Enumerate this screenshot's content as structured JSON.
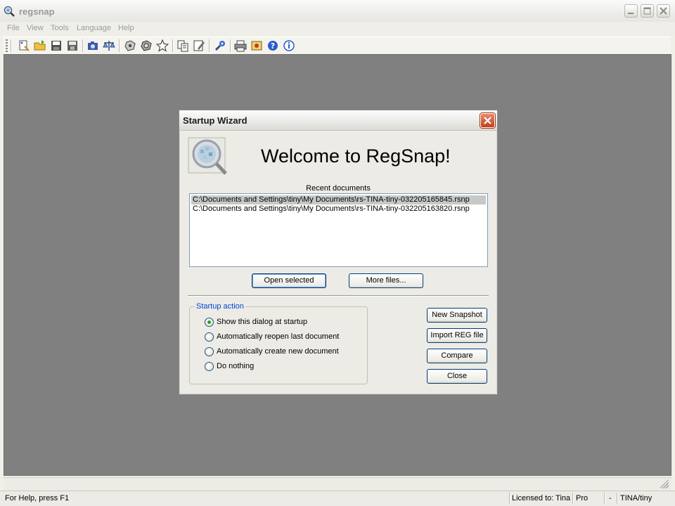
{
  "window": {
    "title": "regsnap",
    "icon": "magnifier-icon"
  },
  "menu": [
    "File",
    "View",
    "Tools",
    "Language",
    "Help"
  ],
  "toolbar": {
    "icons": [
      "new-wizard-icon",
      "open-folder-icon",
      "save-icon",
      "save-as-icon",
      "snapshot-icon",
      "compare-scales-icon",
      "registry-icon",
      "registry-alt-icon",
      "favorites-star-icon",
      "copy-icon",
      "edit-icon",
      "tools-icon",
      "print-icon",
      "settings-icon",
      "help-icon",
      "info-icon"
    ]
  },
  "dialog": {
    "title": "Startup Wizard",
    "welcome": "Welcome to RegSnap!",
    "recent_label": "Recent documents",
    "recent_items": [
      "C:\\Documents and Settings\\tiny\\My Documents\\rs-TINA-tiny-032205165845.rsnp",
      "C:\\Documents and Settings\\tiny\\My Documents\\rs-TINA-tiny-032205163820.rsnp"
    ],
    "open_selected": "Open selected",
    "more_files": "More files...",
    "startup_action_label": "Startup action",
    "options": [
      "Show this dialog at startup",
      "Automatically reopen last document",
      "Automatically create new document",
      "Do nothing"
    ],
    "selected_option": 0,
    "new_snapshot": "New Snapshot",
    "import_reg": "Import REG file",
    "compare": "Compare",
    "close": "Close"
  },
  "status": {
    "help": "For Help, press F1",
    "license": "Licensed to: Tina",
    "edition": "Pro",
    "dash": "-",
    "user": "TINA/tiny"
  },
  "colors": {
    "client_bg": "#808080",
    "close_red": "#d5512c",
    "group_label_blue": "#0046d5"
  }
}
